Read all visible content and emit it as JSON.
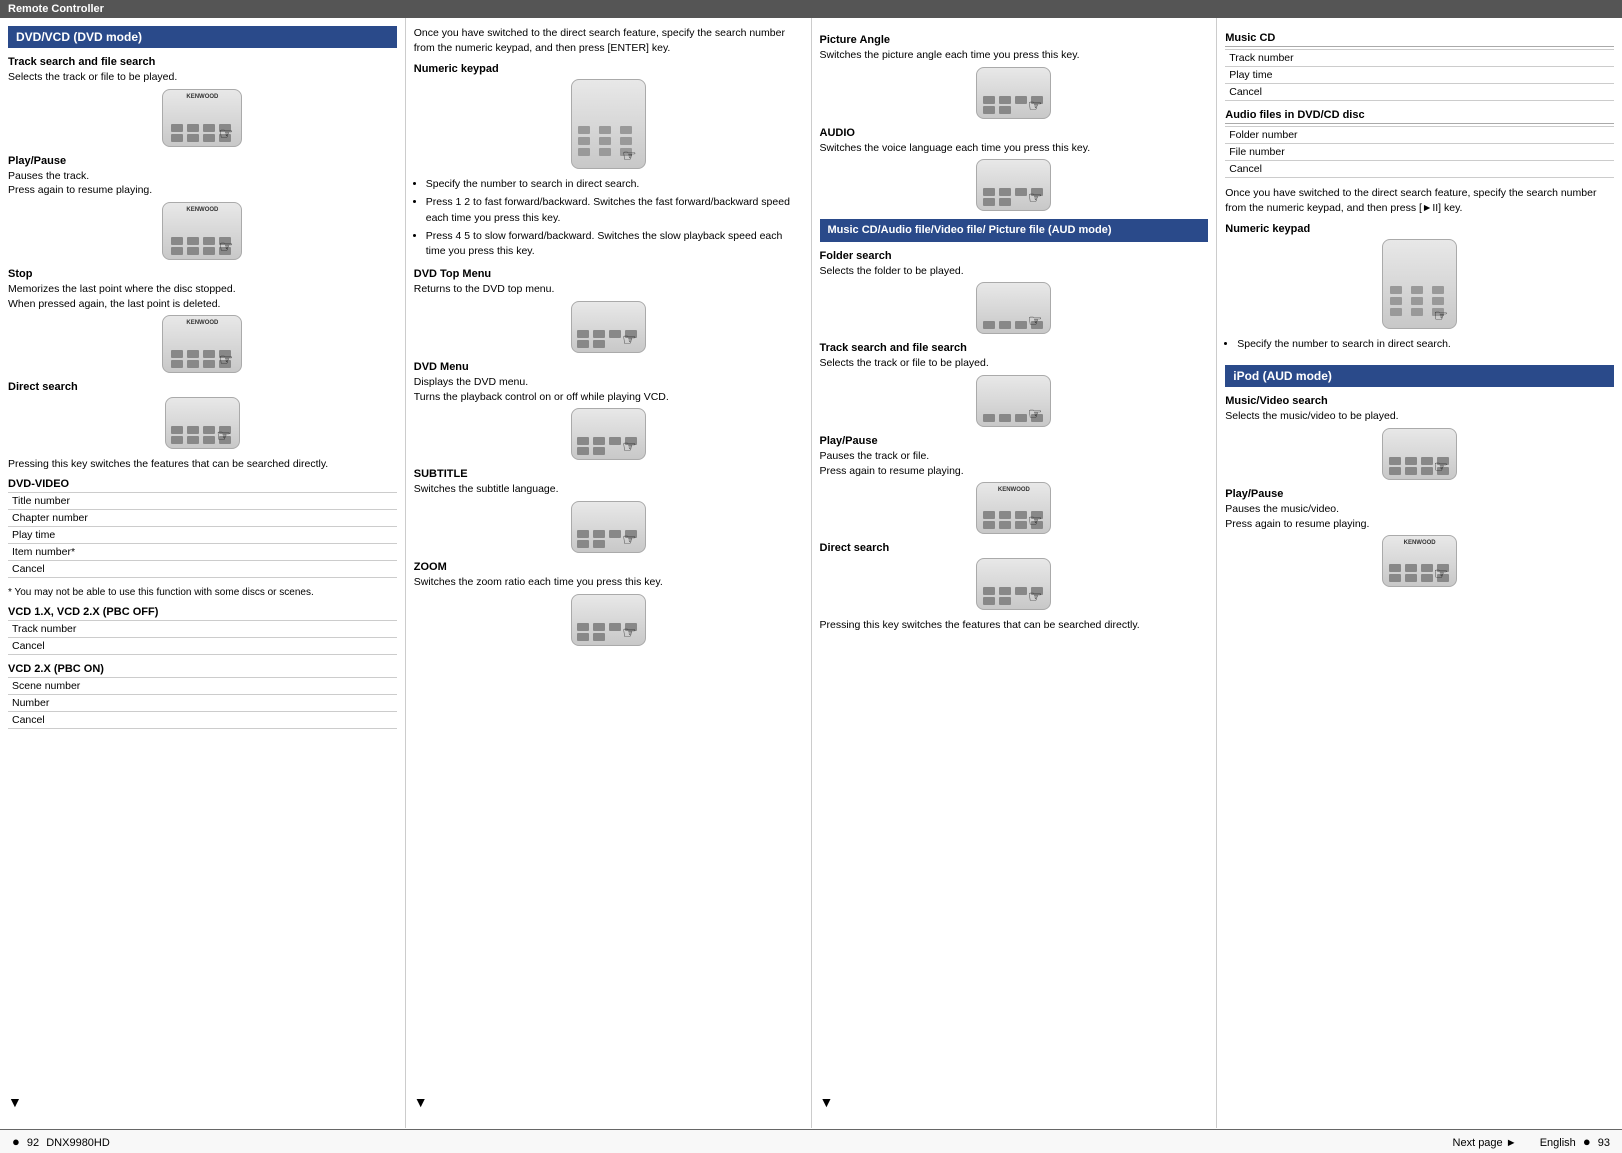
{
  "header": {
    "title": "Remote Controller"
  },
  "footer": {
    "left_page": "92",
    "left_model": "DNX9980HD",
    "right_text": "Next page",
    "right_lang": "English",
    "right_page": "93"
  },
  "col1": {
    "section_title": "DVD/VCD (DVD mode)",
    "track_search_title": "Track search and file search",
    "track_search_desc": "Selects the track or file to be played.",
    "play_pause_title": "Play/Pause",
    "play_pause_desc1": "Pauses the track.",
    "play_pause_desc2": "Press again to resume playing.",
    "stop_title": "Stop",
    "stop_desc1": "Memorizes the last point where the disc stopped.",
    "stop_desc2": "When pressed again, the last point is deleted.",
    "direct_search_title": "Direct search",
    "direct_search_desc": "Pressing this key switches the features that can be searched directly.",
    "dvd_video_label": "DVD-VIDEO",
    "dvd_video_items": [
      "Title number",
      "Chapter number",
      "Play time",
      "Item number*",
      "Cancel"
    ],
    "note": "* You may not be able to use this function with some discs or scenes.",
    "vcd1_label": "VCD 1.X, VCD 2.X (PBC OFF)",
    "vcd1_items": [
      "Track number",
      "Cancel"
    ],
    "vcd2_label": "VCD 2.X (PBC ON)",
    "vcd2_items": [
      "Scene number",
      "Number",
      "Cancel"
    ]
  },
  "col2": {
    "intro_text": "Once you have switched to the direct search feature, specify the search number from the numeric keypad, and then press [ENTER] key.",
    "numeric_keypad_title": "Numeric keypad",
    "bullet1": "Specify the number to search in direct search.",
    "bullet2": "Press 1 2 to fast forward/backward. Switches the fast forward/backward speed each time you press this key.",
    "bullet3": "Press 4 5 to slow forward/backward. Switches the slow playback speed each time you press this key.",
    "dvd_top_menu_title": "DVD Top Menu",
    "dvd_top_menu_desc": "Returns to the DVD top menu.",
    "dvd_menu_title": "DVD Menu",
    "dvd_menu_desc1": "Displays the DVD menu.",
    "dvd_menu_desc2": "Turns the playback control on or off while playing VCD.",
    "subtitle_title": "SUBTITLE",
    "subtitle_desc": "Switches the subtitle language.",
    "zoom_title": "ZOOM",
    "zoom_desc": "Switches the zoom ratio each time you press this key."
  },
  "col3": {
    "picture_angle_title": "Picture Angle",
    "picture_angle_desc": "Switches the picture angle each time you press this key.",
    "audio_title": "AUDIO",
    "audio_desc": "Switches the voice language each time you press this key.",
    "section_title2": "Music CD/Audio file/Video file/ Picture file (AUD mode)",
    "folder_search_title": "Folder search",
    "folder_search_desc": "Selects the folder to be played.",
    "track_search_title2": "Track search and file search",
    "track_search_desc2": "Selects the track or file to be played.",
    "play_pause_title2": "Play/Pause",
    "play_pause_desc3": "Pauses the track or file.",
    "play_pause_desc4": "Press again to resume playing.",
    "direct_search_title2": "Direct search",
    "direct_search_desc2": "Pressing this key switches the features that can be searched directly."
  },
  "col4": {
    "music_cd_title": "Music CD",
    "music_cd_items": [
      "Track number",
      "Play time",
      "Cancel"
    ],
    "audio_files_title": "Audio files in DVD/CD disc",
    "audio_files_items": [
      "Folder number",
      "File number",
      "Cancel"
    ],
    "intro_text2": "Once you have switched to the direct search feature, specify the search number from the numeric keypad, and then press [►II] key.",
    "numeric_keypad_title2": "Numeric keypad",
    "bullet_specify": "Specify the number to search in direct search.",
    "ipod_section_title": "iPod (AUD mode)",
    "music_video_search_title": "Music/Video search",
    "music_video_search_desc": "Selects the music/video to be played.",
    "play_pause_title3": "Play/Pause",
    "play_pause_desc5": "Pauses the music/video.",
    "play_pause_desc6": "Press again to resume playing."
  }
}
